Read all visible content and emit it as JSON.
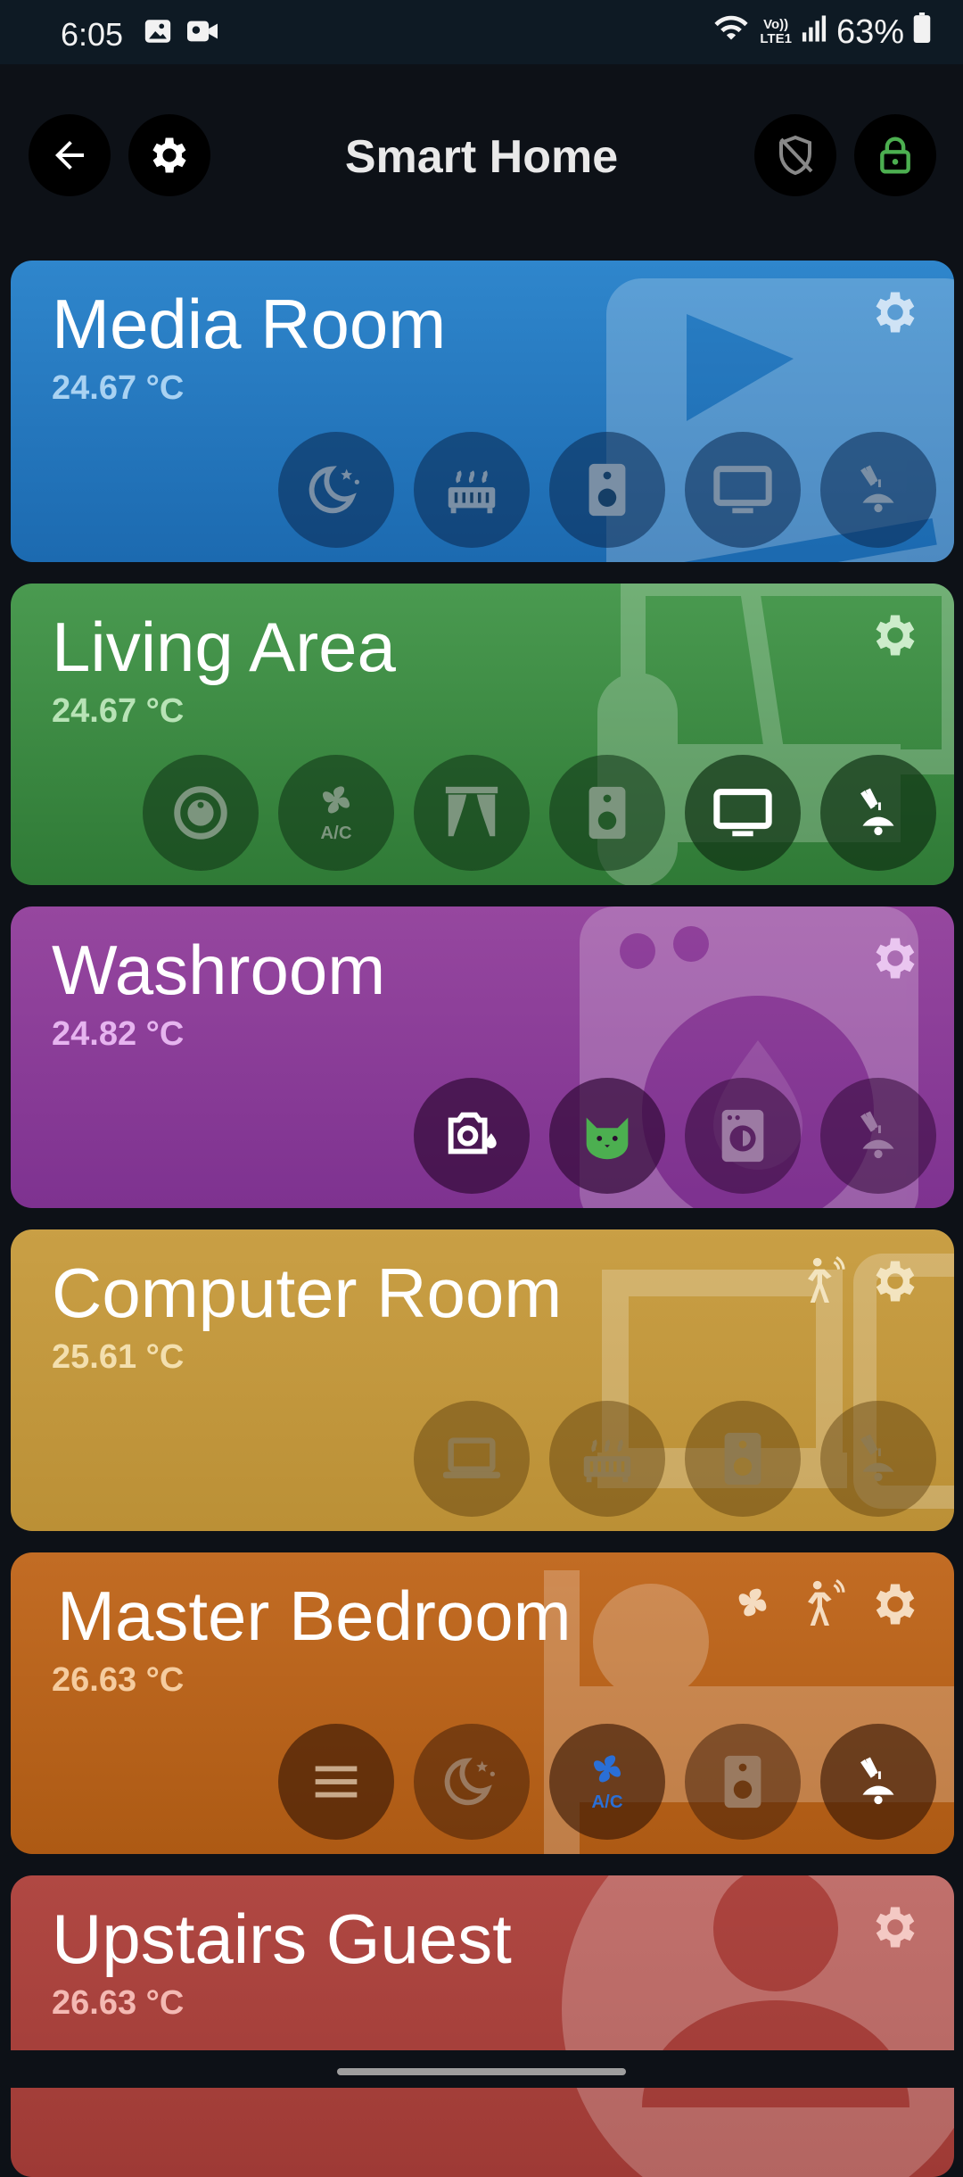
{
  "status_bar": {
    "time": "6:05",
    "lte_line1": "Vo))",
    "lte_line2": "LTE1",
    "battery": "63%",
    "left_icons": [
      "gallery-icon",
      "video-icon"
    ],
    "right_icons": [
      "wifi-icon",
      "signal-icon",
      "battery-icon"
    ]
  },
  "app_bar": {
    "title": "Smart Home",
    "icons": [
      "back-arrow-icon",
      "gear-icon",
      "shield-off-icon",
      "lock-icon"
    ],
    "lock_color": "#4caf50"
  },
  "rooms": [
    {
      "name": "Media Room",
      "temp": "24.67 °C",
      "color": "#2a7bc0",
      "temp_color": "#a9d2f2",
      "devices": [
        "lamp-icon",
        "tv-icon",
        "speaker-icon",
        "heater-icon",
        "sleep-mode-icon"
      ],
      "extra_icons": []
    },
    {
      "name": "Living Area",
      "temp": "24.67 °C",
      "color": "#3e8e46",
      "temp_color": "#b8e3b6",
      "devices": [
        "lamp-icon",
        "tv-icon",
        "speaker-icon",
        "curtains-icon",
        "ac-fan-icon",
        "robot-vacuum-icon"
      ],
      "extra_icons": []
    },
    {
      "name": "Washroom",
      "temp": "24.82 °C",
      "color": "#8c3c9c",
      "temp_color": "#e6b4ef",
      "devices": [
        "lamp-icon",
        "washing-machine-icon",
        "cat-icon",
        "water-heater-icon"
      ],
      "extra_icons": []
    },
    {
      "name": "Computer Room",
      "temp": "25.61 °C",
      "color": "#c59a3e",
      "temp_color": "#f3dfae",
      "devices": [
        "lamp-icon",
        "speaker-icon",
        "heater-icon",
        "laptop-icon"
      ],
      "extra_icons": [
        "motion-sensor-icon"
      ]
    },
    {
      "name": "Master Bedroom",
      "temp": "26.63 °C",
      "color": "#b9631e",
      "temp_color": "#f5cc9f",
      "devices": [
        "lamp-icon",
        "speaker-icon",
        "ac-fan-icon",
        "sleep-mode-icon",
        "menu-icon"
      ],
      "extra_icons": [
        "fan-icon",
        "motion-sensor-icon"
      ]
    },
    {
      "name": "Upstairs Guest",
      "temp": "26.63 °C",
      "color": "#a83e3a",
      "temp_color": "#f4b9b3",
      "devices": [],
      "extra_icons": []
    }
  ]
}
